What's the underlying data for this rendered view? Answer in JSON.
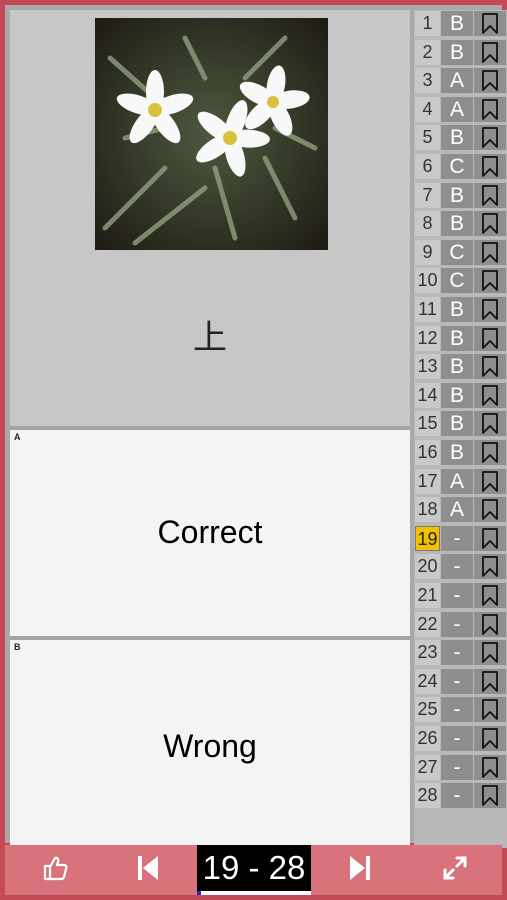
{
  "question": {
    "image_alt": "white daisy flowers",
    "text": "上"
  },
  "answers": [
    {
      "letter": "A",
      "text": "Correct"
    },
    {
      "letter": "B",
      "text": "Wrong"
    }
  ],
  "question_list": [
    {
      "num": "1",
      "answer": "B"
    },
    {
      "num": "2",
      "answer": "B"
    },
    {
      "num": "3",
      "answer": "A"
    },
    {
      "num": "4",
      "answer": "A"
    },
    {
      "num": "5",
      "answer": "B"
    },
    {
      "num": "6",
      "answer": "C"
    },
    {
      "num": "7",
      "answer": "B"
    },
    {
      "num": "8",
      "answer": "B"
    },
    {
      "num": "9",
      "answer": "C"
    },
    {
      "num": "10",
      "answer": "C"
    },
    {
      "num": "11",
      "answer": "B"
    },
    {
      "num": "12",
      "answer": "B"
    },
    {
      "num": "13",
      "answer": "B"
    },
    {
      "num": "14",
      "answer": "B"
    },
    {
      "num": "15",
      "answer": "B"
    },
    {
      "num": "16",
      "answer": "B"
    },
    {
      "num": "17",
      "answer": "A"
    },
    {
      "num": "18",
      "answer": "A"
    },
    {
      "num": "19",
      "answer": "-",
      "current": true
    },
    {
      "num": "20",
      "answer": "-"
    },
    {
      "num": "21",
      "answer": "-"
    },
    {
      "num": "22",
      "answer": "-"
    },
    {
      "num": "23",
      "answer": "-"
    },
    {
      "num": "24",
      "answer": "-"
    },
    {
      "num": "25",
      "answer": "-"
    },
    {
      "num": "26",
      "answer": "-"
    },
    {
      "num": "27",
      "answer": "-"
    },
    {
      "num": "28",
      "answer": "-"
    }
  ],
  "toolbar": {
    "range": "19 - 28",
    "icons": [
      "thumbs-up-icon",
      "skip-previous-icon",
      "skip-next-icon",
      "expand-icon"
    ]
  },
  "colors": {
    "frame": "#c44a57",
    "toolbar": "#d8737c",
    "current_highlight": "#f2c200"
  }
}
